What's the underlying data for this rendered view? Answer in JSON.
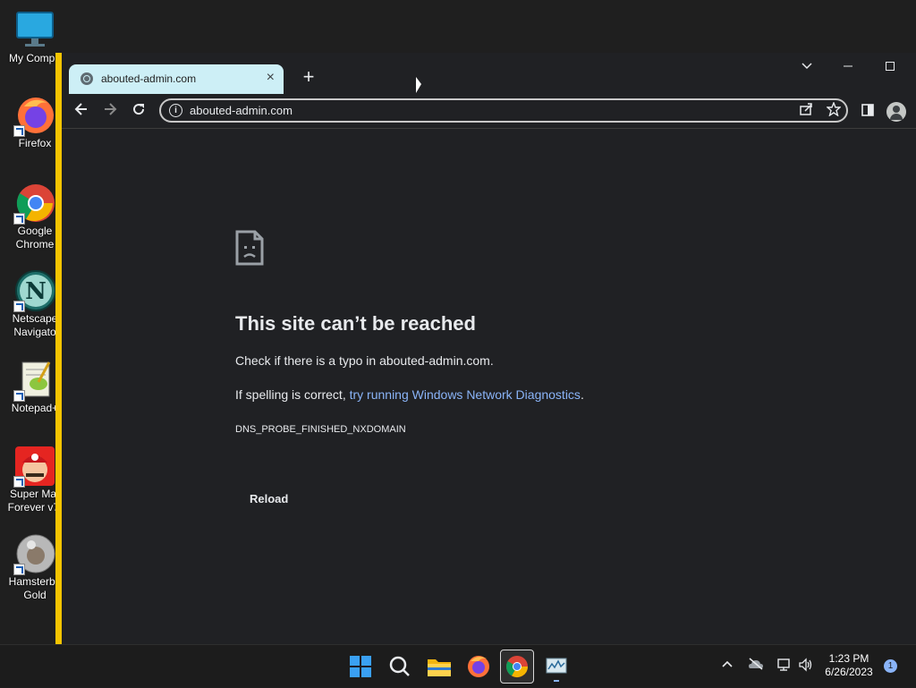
{
  "desktop": {
    "icons": [
      {
        "label": "My Compu"
      },
      {
        "label": "Firefox"
      },
      {
        "label": "Google\nChrome"
      },
      {
        "label": "Netscape\nNavigato"
      },
      {
        "label": "Notepad+"
      },
      {
        "label": "Super Mar\nForever v7."
      },
      {
        "label": "Hamsterba\nGold"
      }
    ]
  },
  "browser": {
    "tab_title": "abouted-admin.com",
    "tab_close": "×",
    "new_tab": "+",
    "url": "abouted-admin.com",
    "info_icon": "i"
  },
  "error_page": {
    "title": "This site can’t be reached",
    "line1": "Check if there is a typo in abouted-admin.com.",
    "line2_prefix": "If spelling is correct, ",
    "line2_link": "try running Windows Network Diagnostics",
    "line2_suffix": ".",
    "code": "DNS_PROBE_FINISHED_NXDOMAIN",
    "reload_label": "Reload"
  },
  "taskbar": {
    "time": "1:23 PM",
    "date": "6/26/2023",
    "notification_count": "1"
  },
  "colors": {
    "window_accent": "#f5c400",
    "tab_active": "#cdeff6",
    "link": "#8ab4f8"
  }
}
